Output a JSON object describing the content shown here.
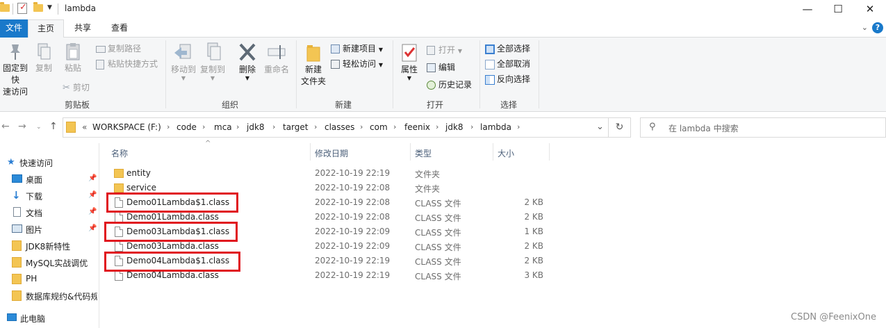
{
  "window": {
    "title": "lambda",
    "minimize_glyph": "—",
    "maximize_glyph": "☐",
    "close_glyph": "✕"
  },
  "ribbon_tabs": [
    "文件",
    "主页",
    "共享",
    "查看"
  ],
  "ribbon": {
    "clipboard": {
      "pin_label_1": "固定到快",
      "pin_label_2": "速访问",
      "copy": "复制",
      "paste": "粘贴",
      "copy_path": "复制路径",
      "paste_shortcut": "粘贴快捷方式",
      "cut": "剪切",
      "group": "剪贴板"
    },
    "organize": {
      "move_to": "移动到",
      "copy_to": "复制到",
      "delete": "删除",
      "rename": "重命名",
      "group": "组织"
    },
    "new": {
      "new_folder_1": "新建",
      "new_folder_2": "文件夹",
      "new_item": "新建项目",
      "easy_access": "轻松访问",
      "group": "新建"
    },
    "open": {
      "properties": "属性",
      "open": "打开",
      "edit": "编辑",
      "history": "历史记录",
      "group": "打开"
    },
    "select": {
      "select_all": "全部选择",
      "select_none": "全部取消",
      "invert": "反向选择",
      "group": "选择"
    }
  },
  "address": {
    "overflow": "«",
    "crumbs": [
      "WORKSPACE (F:)",
      "code",
      "mca",
      "jdk8",
      "target",
      "classes",
      "com",
      "feenix",
      "jdk8",
      "lambda"
    ],
    "search_placeholder": "在 lambda 中搜索"
  },
  "nav_pane": {
    "quick_access": "快速访问",
    "items": [
      "桌面",
      "下载",
      "文档",
      "图片",
      "JDK8新特性",
      "MySQL实战调优",
      "PH",
      "数据库规约&代码规"
    ],
    "this_pc": "此电脑"
  },
  "columns": {
    "name": "名称",
    "modified": "修改日期",
    "type": "类型",
    "size": "大小"
  },
  "files": [
    {
      "name": "entity",
      "modified": "2022-10-19 22:19",
      "type": "文件夹",
      "size": "",
      "kind": "folder"
    },
    {
      "name": "service",
      "modified": "2022-10-19 22:08",
      "type": "文件夹",
      "size": "",
      "kind": "folder"
    },
    {
      "name": "Demo01Lambda$1.class",
      "modified": "2022-10-19 22:08",
      "type": "CLASS 文件",
      "size": "2 KB",
      "kind": "file",
      "highlighted": true
    },
    {
      "name": "Demo01Lambda.class",
      "modified": "2022-10-19 22:08",
      "type": "CLASS 文件",
      "size": "2 KB",
      "kind": "file"
    },
    {
      "name": "Demo03Lambda$1.class",
      "modified": "2022-10-19 22:09",
      "type": "CLASS 文件",
      "size": "1 KB",
      "kind": "file",
      "highlighted": true
    },
    {
      "name": "Demo03Lambda.class",
      "modified": "2022-10-19 22:09",
      "type": "CLASS 文件",
      "size": "2 KB",
      "kind": "file"
    },
    {
      "name": "Demo04Lambda$1.class",
      "modified": "2022-10-19 22:19",
      "type": "CLASS 文件",
      "size": "2 KB",
      "kind": "file",
      "highlighted": true
    },
    {
      "name": "Demo04Lambda.class",
      "modified": "2022-10-19 22:19",
      "type": "CLASS 文件",
      "size": "3 KB",
      "kind": "file"
    }
  ],
  "highlight_color": "#e0141e",
  "accent_color": "#1979ca",
  "watermark": "CSDN @FeenixOne"
}
